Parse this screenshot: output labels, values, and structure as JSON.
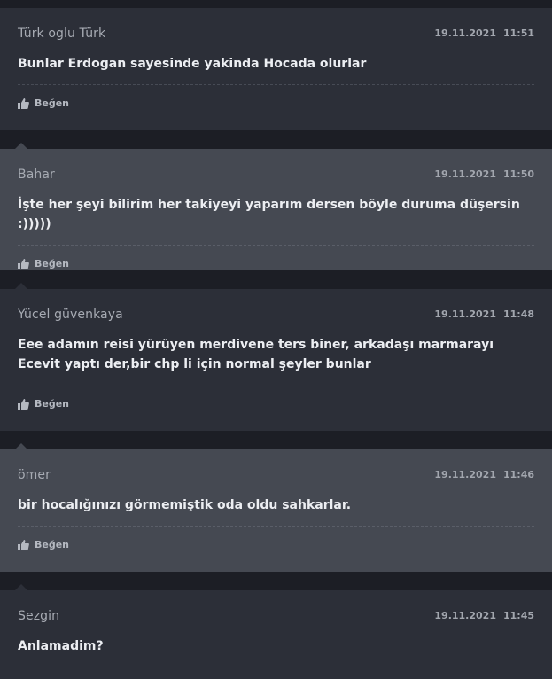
{
  "like_label": "Beğen",
  "colors": {
    "dark_card": "#2c2f38",
    "light_card": "#454952",
    "page_bg": "#1c1e25"
  },
  "comments": [
    {
      "author": "Türk oglu Türk",
      "date": "19.11.2021",
      "time": "11:51",
      "text": "Bunlar Erdogan sayesinde yakinda Hocada olurlar"
    },
    {
      "author": "Bahar",
      "date": "19.11.2021",
      "time": "11:50",
      "text": "İşte her şeyi bilirim her takiyeyi yaparım dersen böyle duruma düşersin :)))))"
    },
    {
      "author": "Yücel güvenkaya",
      "date": "19.11.2021",
      "time": "11:48",
      "text": "Eee adamın reisi yürüyen merdivene ters biner, arkadaşı marmarayı Ecevit yaptı der,bir chp li için normal şeyler bunlar"
    },
    {
      "author": "ömer",
      "date": "19.11.2021",
      "time": "11:46",
      "text": "bir hocalığınızı görmemiştik oda oldu sahkarlar."
    },
    {
      "author": "Sezgin",
      "date": "19.11.2021",
      "time": "11:45",
      "text": "Anlamadim?"
    }
  ]
}
